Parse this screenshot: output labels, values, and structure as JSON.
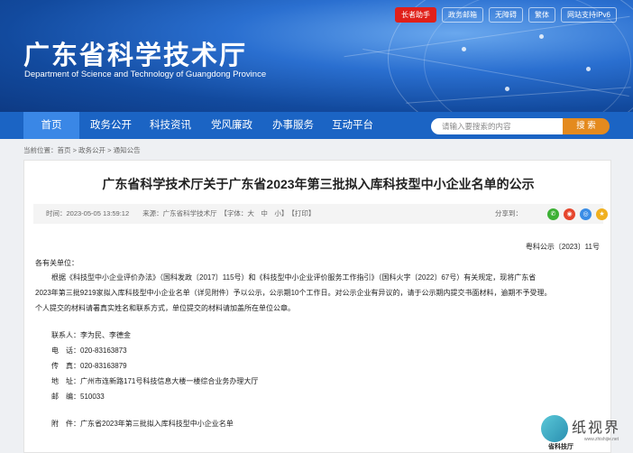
{
  "header": {
    "site_title": "广东省科学技术厅",
    "site_subtitle": "Department of Science and Technology of Guangdong Province",
    "top_links": [
      "长者助手",
      "政务邮箱",
      "无障碍",
      "繁体",
      "网站支持IPv6"
    ]
  },
  "nav": {
    "items": [
      "首页",
      "政务公开",
      "科技资讯",
      "党风廉政",
      "办事服务",
      "互动平台"
    ],
    "active": "首页"
  },
  "search": {
    "placeholder": "请输入要搜索的内容",
    "button": "搜 索"
  },
  "breadcrumb": "当前位置：首页 > 政务公开 > 通知公告",
  "article": {
    "title": "广东省科学技术厅关于广东省2023年第三批拟入库科技型中小企业名单的公示",
    "meta": "时间：2023-05-05 13:59:12　　来源：广东省科学技术厅　【字体：大　中　小】　【打印】",
    "share_label": "分享到：",
    "doc_no": "粤科公示〔2023〕11号",
    "salutation": "各有关单位：",
    "para1_line1": "根据《科技型中小企业评价办法》（国科发政〔2017〕115号）和《科技型中小企业评价服务工作指引》（国科火字〔2022〕67号）有关规定，现将广东省",
    "para1_line2": "2023年第三批9219家拟入库科技型中小企业名单（详见附件）予以公示，公示期10个工作日。对公示企业有异议的，请于公示期内提交书面材料，逾期不予受理。",
    "para1_line3": "个人提交的材料请署真实姓名和联系方式，单位提交的材料请加盖所在单位公章。",
    "contact": "联系人：李为民、李德金",
    "phone": "电　话：020-83163873",
    "fax": "传　真：020-83163879",
    "address": "地　址：广州市连新路171号科技信息大楼一楼综合业务办理大厅",
    "postcode": "邮　编：510033",
    "attachment": "附　件：广东省2023年第三批拟入库科技型中小企业名单"
  },
  "watermark": {
    "text": "纸视界",
    "url": "www.zhishijie.net",
    "under": "省科技厅"
  }
}
